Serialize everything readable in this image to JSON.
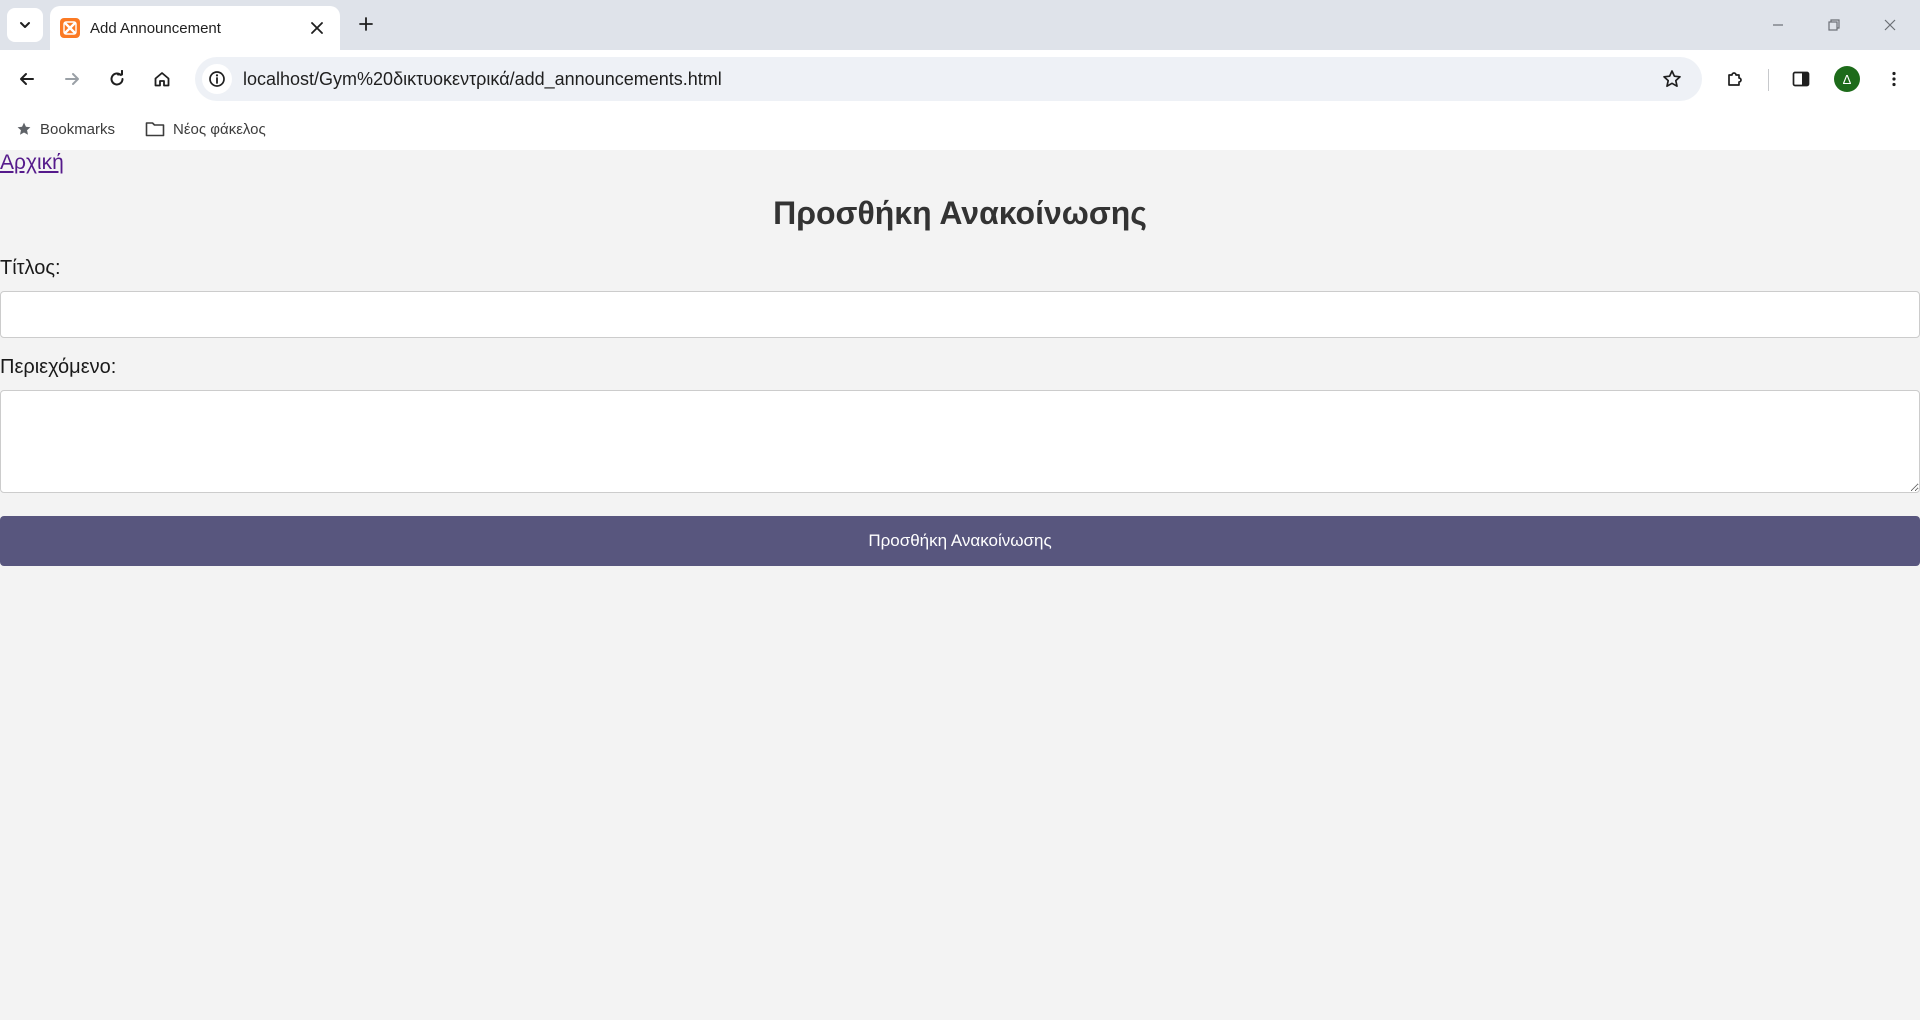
{
  "browser": {
    "tab": {
      "title": "Add Announcement"
    },
    "url": "localhost/Gym%20δικτυοκεντρικά/add_announcements.html",
    "profile_initial": "Δ",
    "bookmarks": [
      {
        "label": "Bookmarks",
        "icon": "star-icon"
      },
      {
        "label": "Νέος φάκελος",
        "icon": "folder-icon"
      }
    ]
  },
  "page": {
    "home_link": "Αρχική",
    "title": "Προσθήκη Ανακοίνωσης",
    "form": {
      "title_label": "Τίτλος:",
      "title_value": "",
      "content_label": "Περιεχόμενο:",
      "content_value": "",
      "submit_label": "Προσθήκη Ανακοίνωσης"
    }
  },
  "colors": {
    "page_background": "#f3f3f3",
    "button_background": "#58567e",
    "heading": "#333333",
    "visited_link": "#551a8b",
    "favicon": "#fb7a24",
    "avatar": "#1d6b1a"
  }
}
